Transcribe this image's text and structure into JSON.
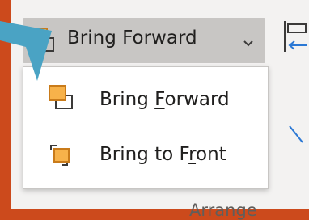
{
  "ribbon": {
    "bring_forward_button": {
      "label": "Bring Forward",
      "icon": "bring-forward-icon",
      "dropdown_icon": "chevron-down-icon"
    },
    "group_label": "Arrange",
    "partial_icons": [
      "align-icon",
      "arrow-icon"
    ]
  },
  "menu": {
    "items": [
      {
        "label_pre": "Bring ",
        "access_key": "F",
        "label_post": "orward",
        "icon": "bring-forward-icon"
      },
      {
        "label_pre": "Bring to F",
        "access_key": "r",
        "label_post": "ont",
        "icon": "bring-to-front-icon"
      }
    ]
  },
  "colors": {
    "background": "#cc4a1c",
    "accent_orange": "#f7b24a",
    "pointer": "#4aa3c4"
  }
}
